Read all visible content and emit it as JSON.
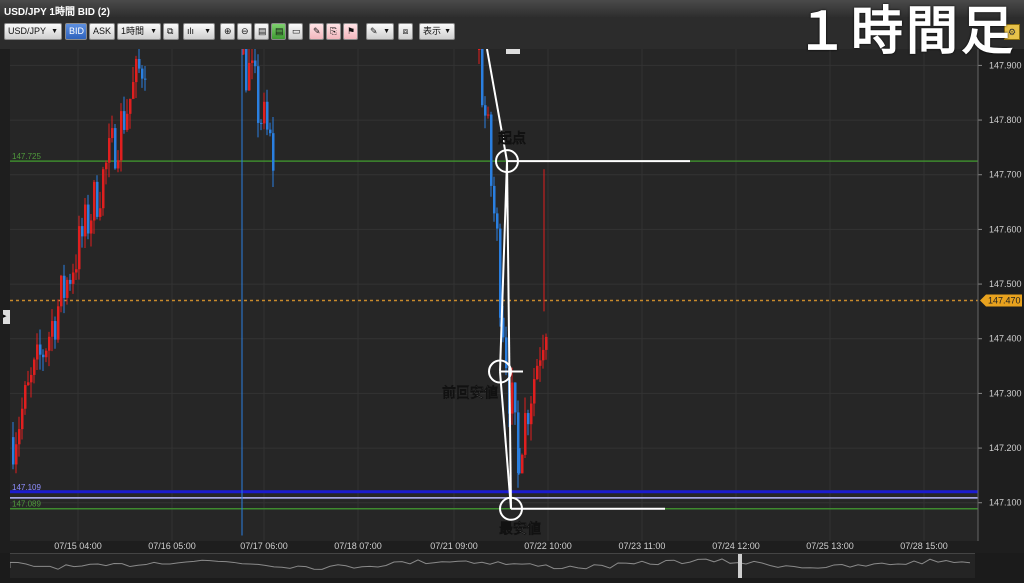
{
  "window": {
    "title": "USD/JPY 1時間 BID (2)",
    "overlay_title": "１時間足"
  },
  "toolbar": {
    "symbol": "USD/JPY",
    "bid_label": "BID",
    "ask_label": "ASK",
    "timeframe": "1時間",
    "display_label": "表示"
  },
  "chart_data": {
    "type": "candlestick",
    "title": "USD/JPY 1時間 BID (2)",
    "ylim": [
      147.03,
      147.93
    ],
    "y_ticks": [
      "147.900",
      "147.800",
      "147.700",
      "147.600",
      "147.500",
      "147.400",
      "147.300",
      "147.200",
      "147.100"
    ],
    "x_ticks": [
      "07/15 04:00",
      "07/16 05:00",
      "07/17 06:00",
      "07/18 07:00",
      "07/21 09:00",
      "07/22 10:00",
      "07/23 11:00",
      "07/24 12:00",
      "07/25 13:00",
      "07/28 15:00"
    ],
    "current_price": "147.470",
    "horizontal_lines": [
      {
        "label": "147.725",
        "value": 147.725,
        "color": "#3e8a2e"
      },
      {
        "label": "147.109",
        "value": 147.12,
        "color": "#1b1bd0"
      },
      {
        "label": "",
        "value": 147.109,
        "color": "#b8b8ff"
      },
      {
        "label": "147.089",
        "value": 147.089,
        "color": "#3e8a2e"
      },
      {
        "label": "",
        "value": 147.47,
        "color": "#c88a2c"
      }
    ],
    "annotations": [
      {
        "text": "起点",
        "price": 147.725
      },
      {
        "text": "前回安値",
        "price": 147.34
      },
      {
        "text": "最安値",
        "price": 147.089
      }
    ],
    "candle_colors": {
      "up": "#e01f1f",
      "down": "#2a7fe0"
    }
  }
}
